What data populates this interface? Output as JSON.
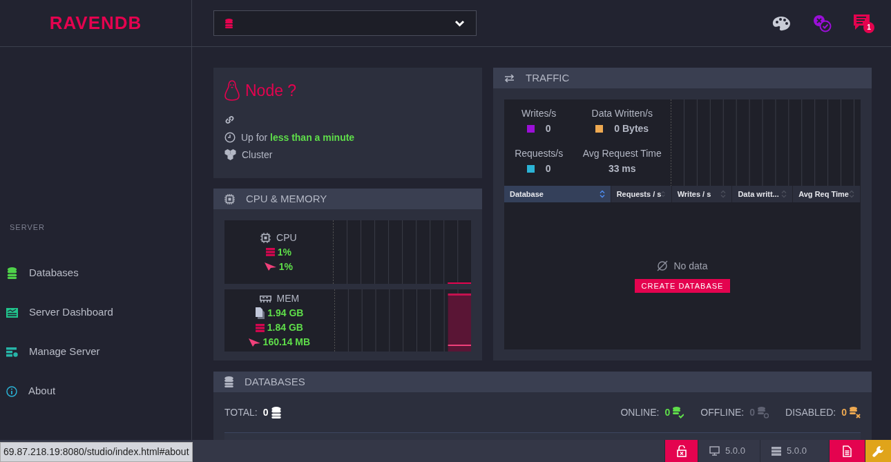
{
  "brand": "RAVENDB",
  "notifications": {
    "count": "1"
  },
  "sidebar": {
    "section": "SERVER",
    "items": [
      {
        "label": "Databases",
        "kind": "databases"
      },
      {
        "label": "Server Dashboard",
        "kind": "dashboard"
      },
      {
        "label": "Manage Server",
        "kind": "manage"
      },
      {
        "label": "About",
        "kind": "about"
      }
    ]
  },
  "node": {
    "title": "Node ?",
    "uptime": "Up for **less than a minute**",
    "cluster": "Cluster"
  },
  "cpu_memory": {
    "title": "CPU & MEMORY",
    "groups": [
      {
        "label": "CPU",
        "kind": "cpu",
        "rows": [
          {
            "kind": "machine",
            "value": "1%"
          },
          {
            "kind": "process",
            "value": "1%"
          }
        ]
      },
      {
        "label": "MEM",
        "kind": "mem",
        "rows": [
          {
            "kind": "mapped",
            "value": "1.94 GB"
          },
          {
            "kind": "machine",
            "value": "1.84 GB"
          },
          {
            "kind": "process",
            "value": "160.14 MB"
          }
        ]
      }
    ]
  },
  "traffic": {
    "title": "TRAFFIC",
    "stats": [
      {
        "label": "Writes/s",
        "value": "0",
        "color": "#9b0fd8"
      },
      {
        "label": "Data Written/s",
        "value": "0 Bytes",
        "color": "#eea951"
      },
      {
        "label": "Requests/s",
        "value": "0",
        "color": "#2bb3d5"
      },
      {
        "label": "Avg Request Time",
        "value": "33 ms"
      }
    ],
    "columns": [
      {
        "label": "Database",
        "sorted": true
      },
      {
        "label": "Requests / s",
        "sorted": false
      },
      {
        "label": "Writes / s",
        "sorted": false
      },
      {
        "label": "Data writt...",
        "sorted": false
      },
      {
        "label": "Avg Req Time",
        "sorted": false
      }
    ],
    "empty": "No data",
    "create_button": "CREATE DATABASE"
  },
  "databases": {
    "title": "DATABASES",
    "total_label": "TOTAL:",
    "total": "0",
    "online_label": "ONLINE:",
    "online": "0",
    "offline_label": "OFFLINE:",
    "offline": "0",
    "disabled_label": "DISABLED:",
    "disabled": "0"
  },
  "footer": {
    "client_version": "5.0.0",
    "server_version": "5.0.0"
  },
  "status_url": "69.87.218.19:8080/studio/index.html#about"
}
